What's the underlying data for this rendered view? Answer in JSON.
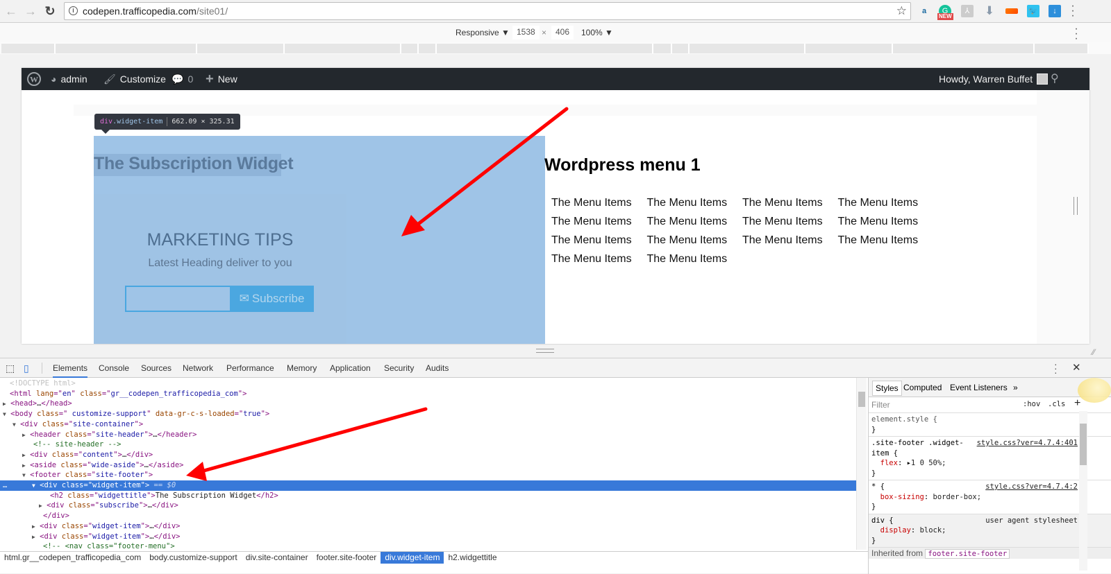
{
  "browser": {
    "url_host": "codepen.trafficopedia.com",
    "url_path": "/site01/",
    "extensions": [
      "amazon-assistant-icon",
      "grammarly-icon",
      "pdf-icon",
      "download-arrow-icon",
      "orange-extension-icon",
      "twitter-icon",
      "download-icon"
    ],
    "ext_badge": "NEW"
  },
  "device_toolbar": {
    "mode": "Responsive",
    "width": "1538",
    "height": "406",
    "zoom": "100%"
  },
  "wp_admin_bar": {
    "site_label": "admin",
    "customize_label": "Customize",
    "comments_count": "0",
    "new_label": "New",
    "howdy": "Howdy, Warren Buffet"
  },
  "tooltip": {
    "tag": "div",
    "class": ".widget-item",
    "size": "662.09 × 325.31"
  },
  "widget": {
    "title": "The Subscription Widget",
    "marketing_title": "MARKETING TIPS",
    "marketing_subtitle": "Latest Heading deliver to you",
    "email_placeholder": "",
    "subscribe_label": "Subscribe"
  },
  "menu_widget": {
    "title": "Wordpress menu 1",
    "items": [
      "The Menu Items",
      "The Menu Items",
      "The Menu Items",
      "The Menu Items",
      "The Menu Items",
      "The Menu Items",
      "The Menu Items",
      "The Menu Items",
      "The Menu Items",
      "The Menu Items",
      "The Menu Items",
      "The Menu Items",
      "The Menu Items",
      "The Menu Items"
    ]
  },
  "devtools": {
    "tabs": [
      "Elements",
      "Console",
      "Sources",
      "Network",
      "Performance",
      "Memory",
      "Application",
      "Security",
      "Audits"
    ],
    "active_tab": "Elements",
    "dom_lines": [
      "<!DOCTYPE html>",
      "<html lang=\"en\" class=\"gr__codepen_trafficopedia_com\">",
      "<head>…</head>",
      "<body class=\" customize-support\" data-gr-c-s-loaded=\"true\">",
      "<div class=\"site-container\">",
      "<header class=\"site-header\">…</header>",
      "<!-- site-header -->",
      "<div class=\"content\">…</div>",
      "<aside class=\"wide-aside\">…</aside>",
      "<footer class=\"site-footer\">",
      "<div class=\"widget-item\"> == $0",
      "<h2 class=\"widgettitle\">The Subscription Widget</h2>",
      "<div class=\"subscribe\">…</div>",
      "</div>",
      "<div class=\"widget-item\">…</div>",
      "<div class=\"widget-item\">…</div>",
      "<!-- <nav class=\"footer-menu\">"
    ],
    "breadcrumbs": [
      "html.gr__codepen_trafficopedia_com",
      "body.customize-support",
      "div.site-container",
      "footer.site-footer",
      "div.widget-item",
      "h2.widgettitle"
    ],
    "active_crumb": "div.widget-item",
    "styles_tabs": [
      "Styles",
      "Computed",
      "Event Listeners",
      "»"
    ],
    "filter_placeholder": "Filter",
    "hov": ":hov",
    "cls": ".cls",
    "rules": {
      "element_style": "element.style {",
      "r1_selector": ".site-footer .widget-item {",
      "r1_source": "style.css?ver=4.7.4:401",
      "r1_prop": "flex",
      "r1_value": "1 0 50%;",
      "r2_selector": "* {",
      "r2_source": "style.css?ver=4.7.4:2",
      "r2_prop": "box-sizing",
      "r2_value": "border-box;",
      "r3_selector": "div {",
      "r3_source": "user agent stylesheet",
      "r3_prop": "display",
      "r3_value": "block;",
      "inherited_label": "Inherited from",
      "inherited_from": "footer.site-footer"
    }
  }
}
